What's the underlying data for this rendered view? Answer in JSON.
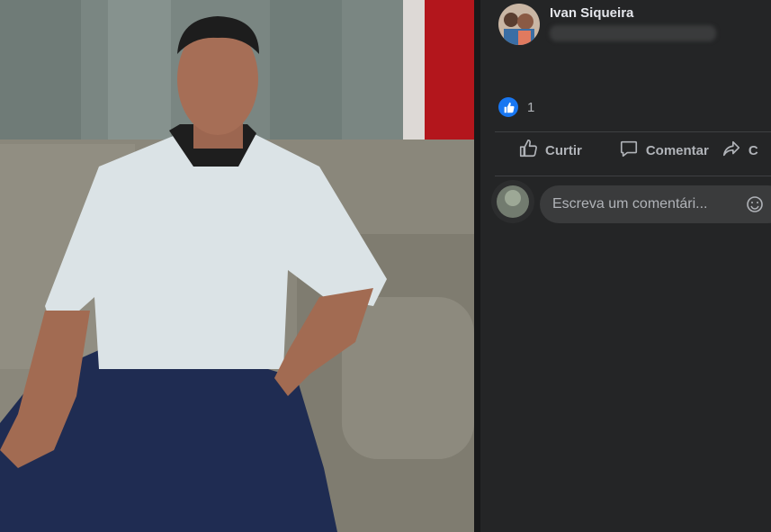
{
  "post": {
    "author": "Ivan Siqueira",
    "like_count": "1"
  },
  "actions": {
    "like_label": "Curtir",
    "comment_label": "Comentar",
    "share_label": "C"
  },
  "comment_input": {
    "placeholder": "Escreva um comentári..."
  },
  "icons": [
    "thumbs-up-icon",
    "comment-bubble-icon",
    "share-arrow-icon",
    "emoji-icon",
    "camera-icon"
  ],
  "colors": {
    "background": "#242526",
    "text_primary": "#e4e6eb",
    "text_secondary": "#b0b3b8",
    "like_blue": "#1877f2",
    "input_bg": "#3a3b3c"
  }
}
